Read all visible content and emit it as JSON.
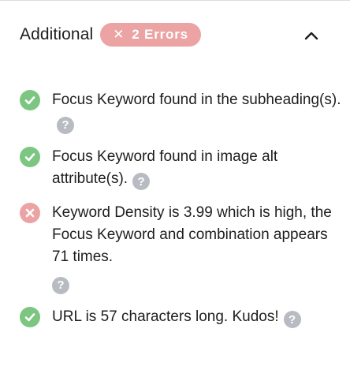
{
  "section": {
    "title": "Additional",
    "badge": {
      "icon": "close-x",
      "label": "2 Errors",
      "color": "#eba3a3"
    },
    "toggle_icon": "chevron-up-icon"
  },
  "checks": [
    {
      "status": "pass",
      "text": "Focus Keyword found in the subheading(s).",
      "help": "?"
    },
    {
      "status": "pass",
      "text": "Focus Keyword found in image alt attribute(s).",
      "help": "?"
    },
    {
      "status": "fail",
      "text": "Keyword Density is 3.99 which is high, the Focus Keyword and combination appears 71 times.",
      "help": "?"
    },
    {
      "status": "pass",
      "text": "URL is 57 characters long. Kudos!",
      "help": "?"
    }
  ],
  "colors": {
    "pass": "#7dc682",
    "fail": "#eba3a3",
    "help": "#b8bcc2"
  }
}
